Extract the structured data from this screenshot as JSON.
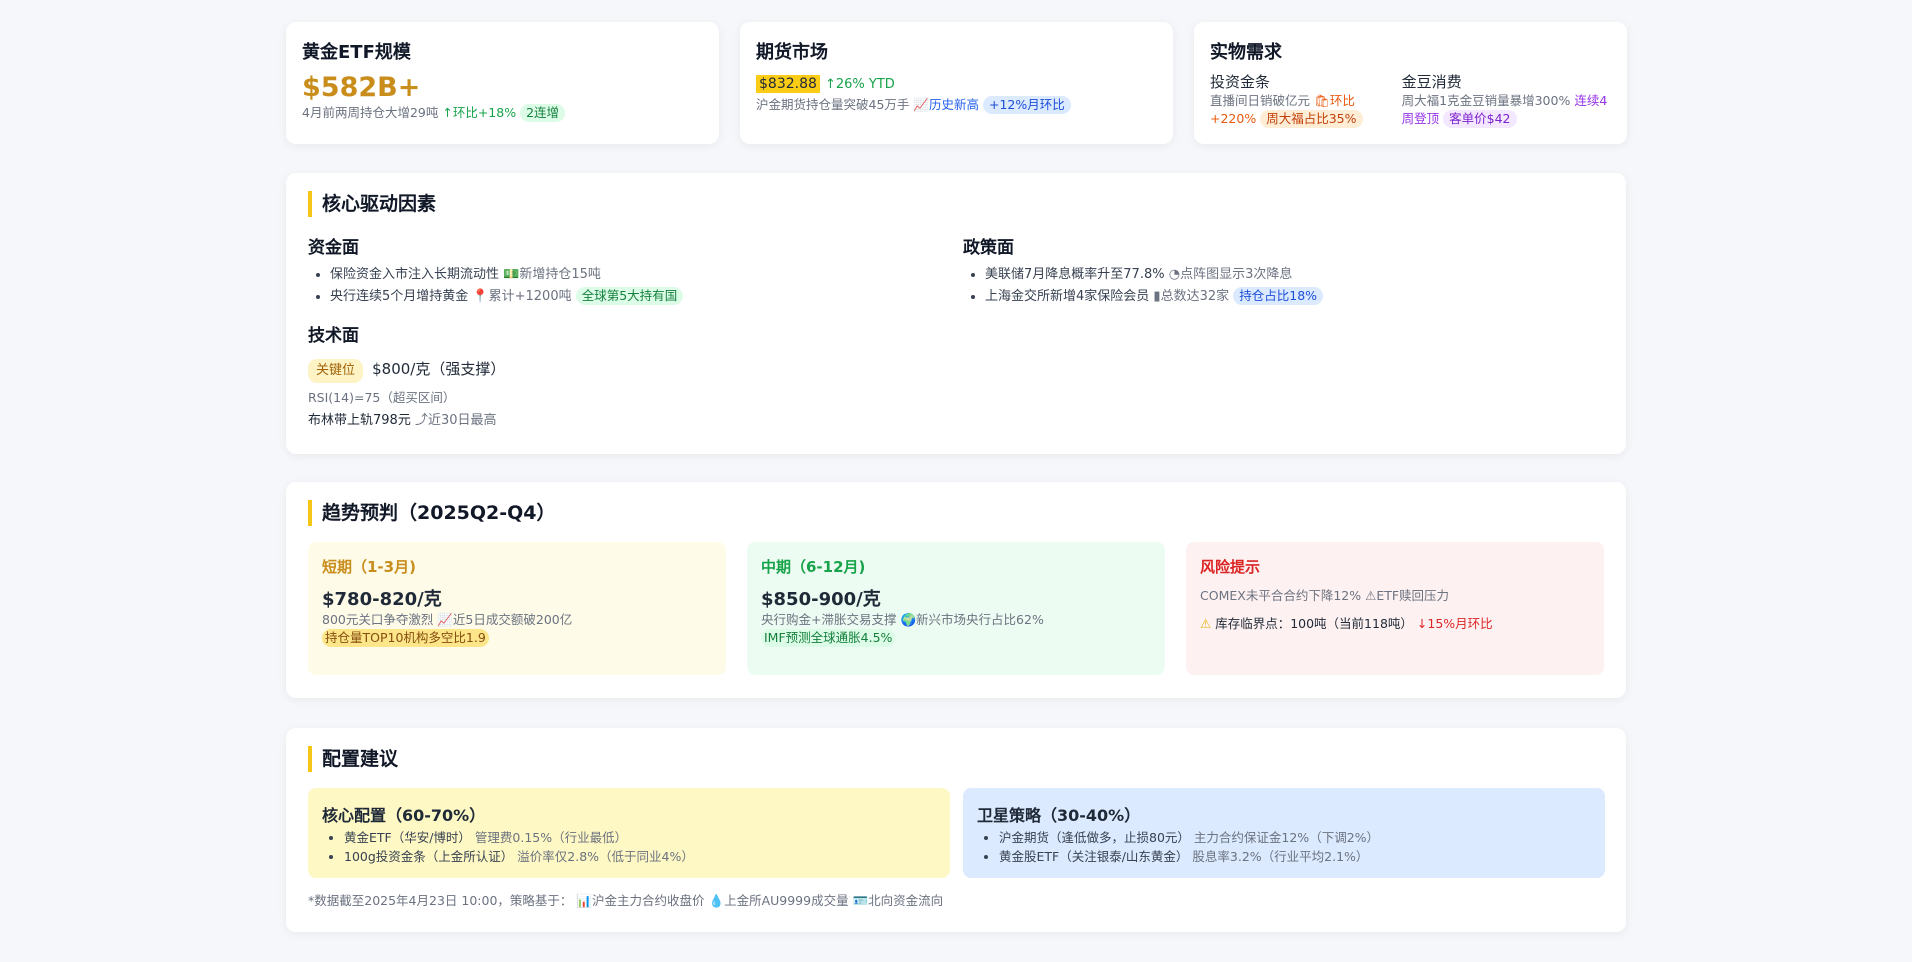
{
  "etf": {
    "title": "黄金ETF规模",
    "value": "$582B+",
    "detail": "4月前两周持仓大增29吨",
    "change": "环比+18%",
    "badge": "2连增"
  },
  "futures": {
    "title": "期货市场",
    "price": "$832.88",
    "ytd": "↑26% YTD",
    "detail": "沪金期货持仓量突破45万手",
    "record": "历史新高",
    "badge": "+12%月环比"
  },
  "physical": {
    "title": "实物需求",
    "bar": {
      "title": "投资金条",
      "detail": "直播间日销破亿元",
      "change": "环比+220%",
      "badge": "周大福占比35%"
    },
    "bean": {
      "title": "金豆消费",
      "detail": "周大福1克金豆销量暴增300%",
      "streak": "连续4周登顶",
      "badge": "客单价$42"
    }
  },
  "drivers": {
    "title": "核心驱动因素",
    "capital": {
      "title": "资金面",
      "items": [
        {
          "text": "保险资金入市注入长期流动性",
          "note": "新增持仓15吨",
          "badge": ""
        },
        {
          "text": "央行连续5个月增持黄金",
          "note": "累计+1200吨",
          "badge": "全球第5大持有国"
        }
      ]
    },
    "policy": {
      "title": "政策面",
      "items": [
        {
          "text": "美联储7月降息概率升至77.8%",
          "note": "点阵图显示3次降息",
          "badge": ""
        },
        {
          "text": "上海金交所新增4家保险会员",
          "note": "总数达32家",
          "badge": "持仓占比18%"
        }
      ]
    },
    "technical": {
      "title": "技术面",
      "key_label": "关键位",
      "key_value": "$800/克（强支撑）",
      "rsi": "RSI(14)=75（超买区间）",
      "boll": "布林带上轨798元",
      "boll_note": "近30日最高"
    }
  },
  "trend": {
    "title": "趋势预判（2025Q2-Q4）",
    "short": {
      "title": "短期（1-3月)",
      "range": "$780-820/克",
      "detail": "800元关口争夺激烈",
      "note": "近5日成交额破200亿",
      "badge": "持仓量TOP10机构多空比1.9"
    },
    "mid": {
      "title": "中期（6-12月)",
      "range": "$850-900/克",
      "detail": "央行购金+滞胀交易支撑",
      "note": "新兴市场央行占比62%",
      "badge": "IMF预测全球通胀4.5%"
    },
    "risk": {
      "title": "风险提示",
      "line1": "COMEX未平合合约下降12%",
      "line1_note": "ETF赎回压力",
      "line2": "库存临界点：100吨（当前118吨）",
      "line2_note": "↓15%月环比"
    }
  },
  "config": {
    "title": "配置建议",
    "core": {
      "title": "核心配置（60-70%）",
      "items": [
        {
          "text": "黄金ETF（华安/博时）",
          "note": "管理费0.15%（行业最低）"
        },
        {
          "text": "100g投资金条（上金所认证）",
          "note": "溢价率仅2.8%（低于同业4%）"
        }
      ]
    },
    "satellite": {
      "title": "卫星策略（30-40%）",
      "items": [
        {
          "text": "沪金期货（逢低做多，止损80元）",
          "note": "主力合约保证金12%（下调2%）"
        },
        {
          "text": "黄金股ETF（关注银泰/山东黄金）",
          "note": "股息率3.2%（行业平均2.1%）"
        }
      ]
    },
    "footnote": "*数据截至2025年4月23日 10:00，策略基于：",
    "sources": [
      "沪金主力合约收盘价",
      "上金所AU9999成交量",
      "北向资金流向"
    ]
  },
  "colors": {
    "accent": "#f5c518",
    "gold": "#c98d1b",
    "green": "#16a34a",
    "red": "#dc2626"
  }
}
